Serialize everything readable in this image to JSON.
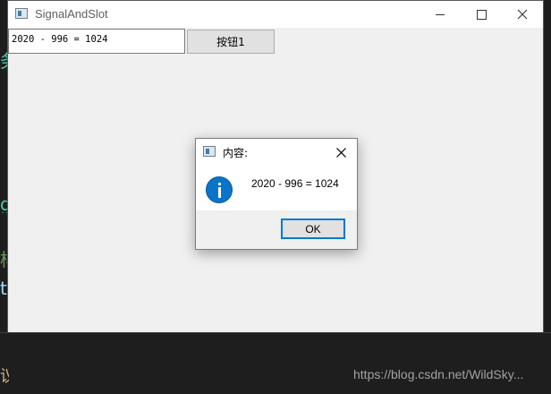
{
  "window": {
    "title": "SignalAndSlot"
  },
  "main": {
    "line_edit_value": "2020 - 996 = 1024",
    "push_button_label": "按钮1"
  },
  "dialog": {
    "title": "内容:",
    "message": "2020 - 996 = 1024",
    "ok_label": "OK",
    "icon": "info-icon"
  },
  "watermark": "https://blog.csdn.net/WildSky..."
}
